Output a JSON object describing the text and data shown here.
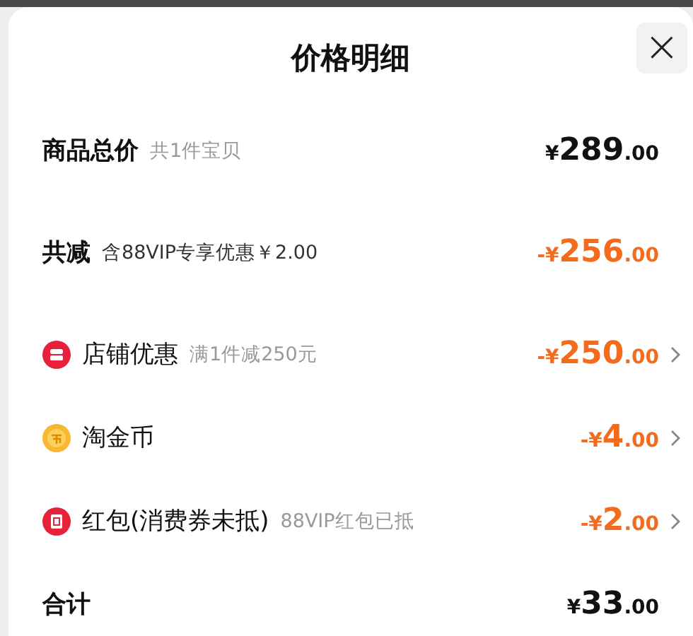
{
  "title": "价格明细",
  "close": {
    "label": "×"
  },
  "rows": [
    {
      "kind": "summary",
      "label": "商品总价",
      "note": "共1件宝贝",
      "discount": false,
      "amount": {
        "currency": "¥",
        "whole": "289",
        "cents": ".00"
      }
    },
    {
      "kind": "summary",
      "label": "共减",
      "note": "含88VIP专享优惠￥2.00",
      "discount": true,
      "amount": {
        "currency": "-¥",
        "whole": "256",
        "cents": ".00"
      }
    },
    {
      "kind": "shop",
      "label": "店铺优惠",
      "note": "满1件减250元",
      "discount": true,
      "amount": {
        "currency": "-¥",
        "whole": "250",
        "cents": ".00"
      }
    },
    {
      "kind": "coin",
      "label": "淘金币",
      "discount": true,
      "amount": {
        "currency": "-¥",
        "whole": "4",
        "cents": ".00"
      }
    },
    {
      "kind": "envelope",
      "label": "红包(消费券未抵)",
      "note": "88VIP红包已抵",
      "discount": true,
      "amount": {
        "currency": "-¥",
        "whole": "2",
        "cents": ".00"
      }
    },
    {
      "kind": "summary",
      "label": "合计",
      "discount": false,
      "amount": {
        "currency": "¥",
        "whole": "33",
        "cents": ".00"
      }
    }
  ]
}
